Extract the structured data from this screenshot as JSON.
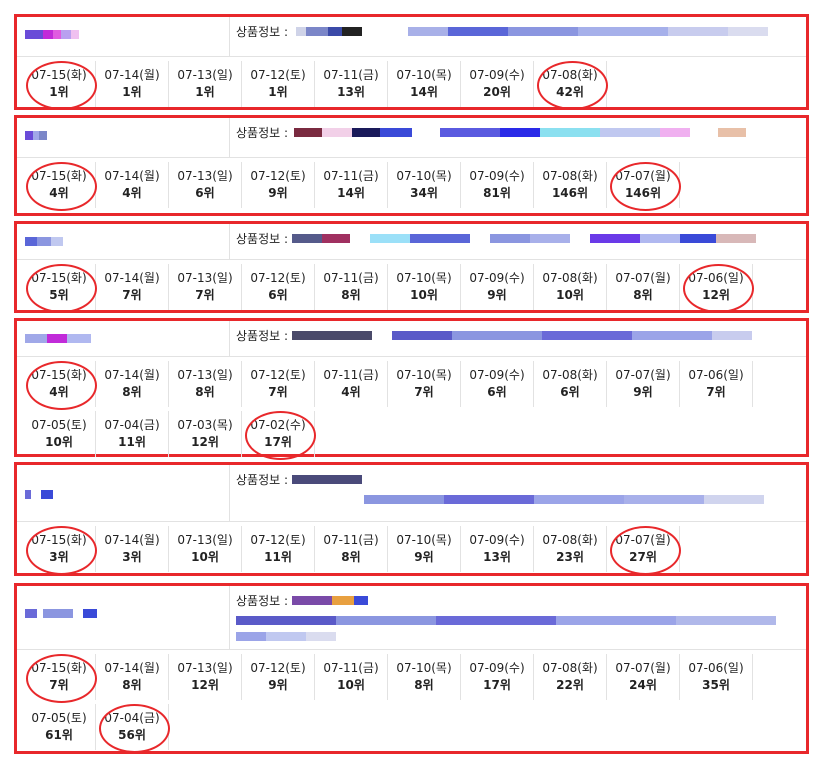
{
  "accent_color": "#e8282b",
  "info_label": "상품정보 :",
  "cards": [
    {
      "ranks": [
        {
          "date": "07-15(화)",
          "rank": "1위",
          "circled": true
        },
        {
          "date": "07-14(월)",
          "rank": "1위"
        },
        {
          "date": "07-13(일)",
          "rank": "1위"
        },
        {
          "date": "07-12(토)",
          "rank": "1위"
        },
        {
          "date": "07-11(금)",
          "rank": "13위"
        },
        {
          "date": "07-10(목)",
          "rank": "14위"
        },
        {
          "date": "07-09(수)",
          "rank": "20위"
        },
        {
          "date": "07-08(화)",
          "rank": "42위",
          "circled": true
        }
      ]
    },
    {
      "ranks": [
        {
          "date": "07-15(화)",
          "rank": "4위",
          "circled": true
        },
        {
          "date": "07-14(월)",
          "rank": "4위"
        },
        {
          "date": "07-13(일)",
          "rank": "6위"
        },
        {
          "date": "07-12(토)",
          "rank": "9위"
        },
        {
          "date": "07-11(금)",
          "rank": "14위"
        },
        {
          "date": "07-10(목)",
          "rank": "34위"
        },
        {
          "date": "07-09(수)",
          "rank": "81위"
        },
        {
          "date": "07-08(화)",
          "rank": "146위"
        },
        {
          "date": "07-07(월)",
          "rank": "146위",
          "circled": true
        }
      ]
    },
    {
      "ranks": [
        {
          "date": "07-15(화)",
          "rank": "5위",
          "circled": true
        },
        {
          "date": "07-14(월)",
          "rank": "7위"
        },
        {
          "date": "07-13(일)",
          "rank": "7위"
        },
        {
          "date": "07-12(토)",
          "rank": "6위"
        },
        {
          "date": "07-11(금)",
          "rank": "8위"
        },
        {
          "date": "07-10(목)",
          "rank": "10위"
        },
        {
          "date": "07-09(수)",
          "rank": "9위"
        },
        {
          "date": "07-08(화)",
          "rank": "10위"
        },
        {
          "date": "07-07(월)",
          "rank": "8위"
        },
        {
          "date": "07-06(일)",
          "rank": "12위",
          "circled": true
        }
      ]
    },
    {
      "ranks": [
        {
          "date": "07-15(화)",
          "rank": "4위",
          "circled": true
        },
        {
          "date": "07-14(월)",
          "rank": "8위"
        },
        {
          "date": "07-13(일)",
          "rank": "8위"
        },
        {
          "date": "07-12(토)",
          "rank": "7위"
        },
        {
          "date": "07-11(금)",
          "rank": "4위"
        },
        {
          "date": "07-10(목)",
          "rank": "7위"
        },
        {
          "date": "07-09(수)",
          "rank": "6위"
        },
        {
          "date": "07-08(화)",
          "rank": "6위"
        },
        {
          "date": "07-07(월)",
          "rank": "9위"
        },
        {
          "date": "07-06(일)",
          "rank": "7위"
        },
        {
          "date": "07-05(토)",
          "rank": "10위"
        },
        {
          "date": "07-04(금)",
          "rank": "11위"
        },
        {
          "date": "07-03(목)",
          "rank": "12위"
        },
        {
          "date": "07-02(수)",
          "rank": "17위",
          "circled": true
        }
      ]
    },
    {
      "ranks": [
        {
          "date": "07-15(화)",
          "rank": "3위",
          "circled": true
        },
        {
          "date": "07-14(월)",
          "rank": "3위"
        },
        {
          "date": "07-13(일)",
          "rank": "10위"
        },
        {
          "date": "07-12(토)",
          "rank": "11위"
        },
        {
          "date": "07-11(금)",
          "rank": "8위"
        },
        {
          "date": "07-10(목)",
          "rank": "9위"
        },
        {
          "date": "07-09(수)",
          "rank": "13위"
        },
        {
          "date": "07-08(화)",
          "rank": "23위"
        },
        {
          "date": "07-07(월)",
          "rank": "27위",
          "circled": true
        }
      ]
    },
    {
      "ranks": [
        {
          "date": "07-15(화)",
          "rank": "7위",
          "circled": true
        },
        {
          "date": "07-14(월)",
          "rank": "8위"
        },
        {
          "date": "07-13(일)",
          "rank": "12위"
        },
        {
          "date": "07-12(토)",
          "rank": "9위"
        },
        {
          "date": "07-11(금)",
          "rank": "10위"
        },
        {
          "date": "07-10(목)",
          "rank": "8위"
        },
        {
          "date": "07-09(수)",
          "rank": "17위"
        },
        {
          "date": "07-08(화)",
          "rank": "22위"
        },
        {
          "date": "07-07(월)",
          "rank": "24위"
        },
        {
          "date": "07-06(일)",
          "rank": "35위"
        },
        {
          "date": "07-05(토)",
          "rank": "61위"
        },
        {
          "date": "07-04(금)",
          "rank": "56위",
          "circled": true
        }
      ]
    }
  ]
}
